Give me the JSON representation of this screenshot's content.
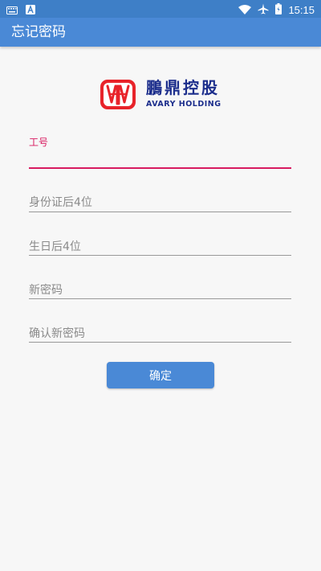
{
  "status_bar": {
    "time": "15:15",
    "icons": [
      "keyboard-icon",
      "a-badge-icon",
      "wifi-icon",
      "airplane-icon",
      "battery-icon"
    ]
  },
  "app_bar": {
    "title": "忘记密码"
  },
  "brand": {
    "name_cn": "鵬鼎控股",
    "name_en": "AVARY HOLDING",
    "logo_color": "#e8232a",
    "text_color": "#1c2e8c"
  },
  "form": {
    "employee_id": {
      "label": "工号",
      "value": ""
    },
    "id_last4": {
      "placeholder": "身份证后4位"
    },
    "birthday_last4": {
      "placeholder": "生日后4位"
    },
    "new_password": {
      "placeholder": "新密码"
    },
    "confirm_password": {
      "placeholder": "确认新密码"
    },
    "submit_label": "确定"
  },
  "colors": {
    "primary": "#4a89d6",
    "status_bar": "#3e7fc7",
    "accent": "#d81b60",
    "background": "#f7f7f7"
  }
}
